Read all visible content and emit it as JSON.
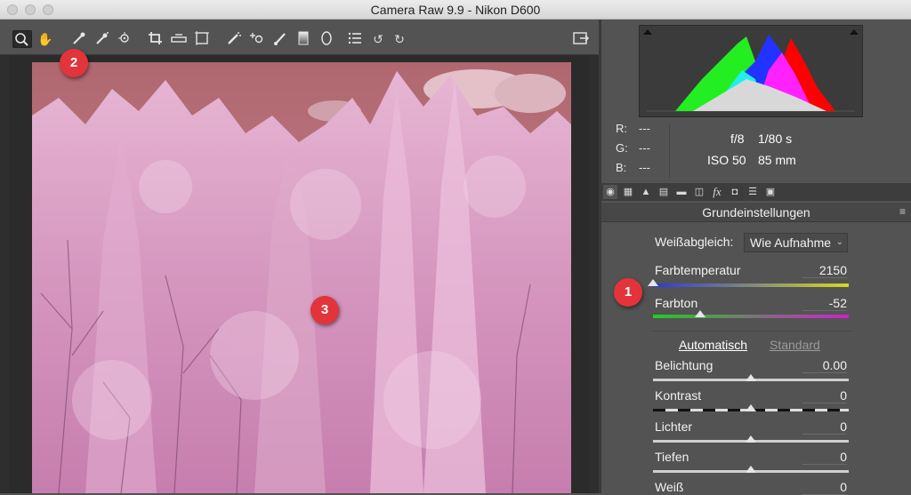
{
  "window": {
    "title": "Camera Raw 9.9 - Nikon D600"
  },
  "toolbar": {
    "icons": [
      "zoom-icon",
      "hand-icon",
      "white-balance-icon",
      "color-sampler-icon",
      "targeted-adjustment-icon",
      "crop-icon",
      "straighten-icon",
      "transform-icon",
      "spot-removal-icon",
      "red-eye-icon",
      "adjustment-brush-icon",
      "graduated-filter-icon",
      "radial-filter-icon",
      "preferences-icon",
      "rotate-ccw-icon",
      "rotate-cw-icon",
      "toggle-fullscreen-icon"
    ]
  },
  "histogram": {
    "colors": {
      "red": "#ff0000",
      "green": "#22ee22",
      "blue": "#2233ff",
      "cyan": "#22eeee",
      "magenta": "#ff22ff",
      "luminance": "#d8d8d8"
    }
  },
  "info": {
    "r_label": "R:",
    "r_value": "---",
    "g_label": "G:",
    "g_value": "---",
    "b_label": "B:",
    "b_value": "---",
    "aperture": "f/8",
    "shutter": "1/80 s",
    "iso": "ISO 50",
    "focal": "85 mm"
  },
  "panel_tabs": [
    "basic-icon",
    "tone-curve-icon",
    "detail-icon",
    "hsl-icon",
    "split-toning-icon",
    "lens-icon",
    "fx-icon",
    "camera-calibration-icon",
    "presets-icon",
    "snapshots-icon"
  ],
  "panel": {
    "title": "Grundeinstellungen",
    "wb_label": "Weißabgleich:",
    "wb_value": "Wie Aufnahme",
    "auto_label": "Automatisch",
    "default_label": "Standard"
  },
  "sliders": [
    {
      "label": "Farbtemperatur",
      "value": "2150",
      "level": 0.0
    },
    {
      "label": "Farbton",
      "value": "-52",
      "level": 0.24
    },
    {
      "label": "Belichtung",
      "value": "0.00",
      "level": 0.5
    },
    {
      "label": "Kontrast",
      "value": "0",
      "level": 0.5
    },
    {
      "label": "Lichter",
      "value": "0",
      "level": 0.5
    },
    {
      "label": "Tiefen",
      "value": "0",
      "level": 0.5
    },
    {
      "label": "Weiß",
      "value": "0",
      "level": 0.5
    }
  ],
  "badges": [
    "1",
    "2",
    "3"
  ]
}
